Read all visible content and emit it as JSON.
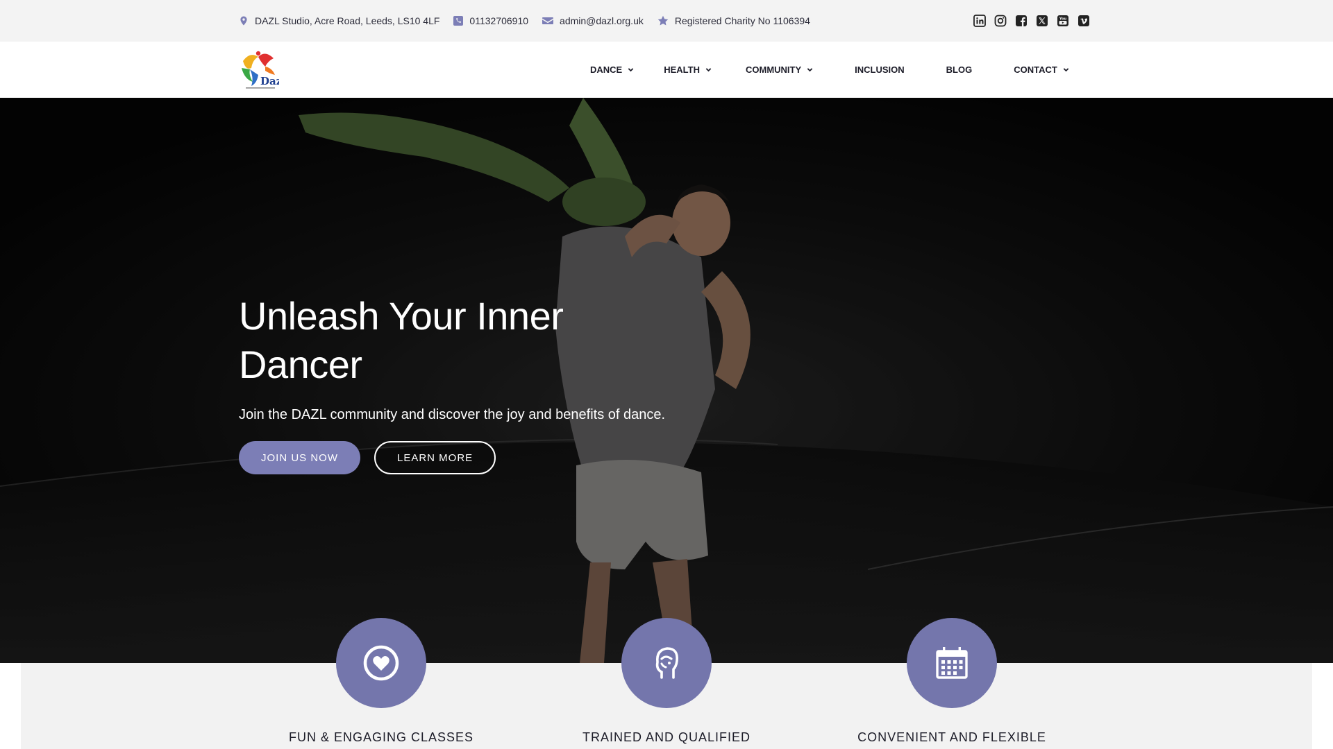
{
  "topbar": {
    "address": "DAZL Studio, Acre Road, Leeds, LS10 4LF",
    "phone": "01132706910",
    "email": "admin@dazl.org.uk",
    "charity": "Registered Charity No 1106394",
    "social_icons": [
      "linkedin-icon",
      "instagram-icon",
      "facebook-icon",
      "x-twitter-icon",
      "youtube-icon",
      "vimeo-icon"
    ]
  },
  "nav": {
    "logo_text": "Dazl",
    "items": [
      {
        "label": "DANCE",
        "has_dropdown": true
      },
      {
        "label": "HEALTH",
        "has_dropdown": true
      },
      {
        "label": "COMMUNITY",
        "has_dropdown": true
      },
      {
        "label": "INCLUSION",
        "has_dropdown": false
      },
      {
        "label": "BLOG",
        "has_dropdown": false
      },
      {
        "label": "CONTACT",
        "has_dropdown": true
      }
    ]
  },
  "hero": {
    "title_line1": "Unleash Your Inner",
    "title_line2": "Dancer",
    "subtitle": "Join the DAZL community and discover the joy and benefits of dance.",
    "primary_button": "JOIN US NOW",
    "secondary_button": "LEARN MORE"
  },
  "features": [
    {
      "title": "FUN & ENGAGING CLASSES",
      "icon": "heart-icon"
    },
    {
      "title": "TRAINED AND QUALIFIED",
      "icon": "head-icon"
    },
    {
      "title": "CONVENIENT AND FLEXIBLE",
      "icon": "calendar-icon"
    }
  ],
  "colors": {
    "accent": "#7c7eb6",
    "feature_circle": "#7476ac",
    "topbar_bg": "#f3f3f3",
    "text_dark": "#1c1c28"
  }
}
